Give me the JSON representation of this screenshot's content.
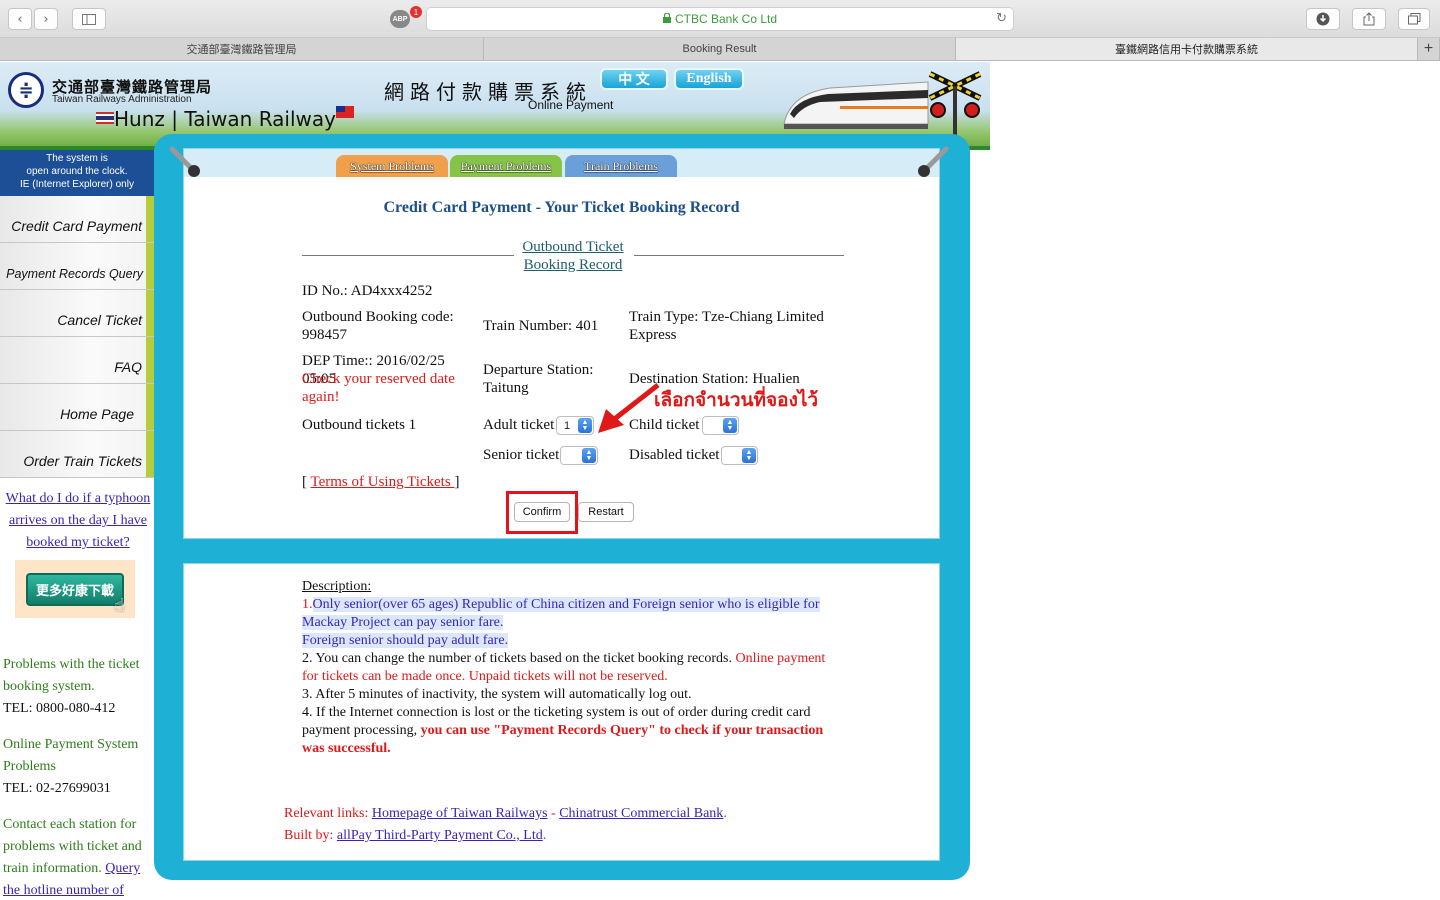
{
  "browser": {
    "url": "CTBC Bank Co Ltd",
    "abp_label": "ABP",
    "abp_badge": "1",
    "tabs": [
      {
        "label": "交通部臺灣鐵路管理局"
      },
      {
        "label": "Booking Result"
      },
      {
        "label": "臺鐵網路信用卡付款購票系統"
      }
    ]
  },
  "header": {
    "org_cn": "交通部臺灣鐵路管理局",
    "org_en": "Taiwan Railways Administration",
    "watermark": "Hunz | Taiwan Railway",
    "system_cn": "網路付款購票系統",
    "system_en": "Online Payment",
    "lang_cn": "中 文",
    "lang_en": "English"
  },
  "sidebar": {
    "system_note": [
      "The system is",
      "open around the clock.",
      "IE (Internet Explorer) only"
    ],
    "nav": [
      {
        "label": "Credit Card Payment"
      },
      {
        "label": "Payment Records Query"
      },
      {
        "label": "Cancel Ticket"
      },
      {
        "label": "FAQ"
      },
      {
        "label": "Home Page"
      },
      {
        "label": "Order Train Tickets"
      }
    ],
    "typhoon_link": "What do I do if a typhoon arrives on the day I have booked my ticket?",
    "download_banner": "更多好康下載",
    "ticket_problems": "Problems with the ticket booking system.",
    "ticket_tel": "TEL: 0800-080-412",
    "payment_problems": "Online Payment System Problems",
    "payment_tel": "TEL: 02-27699031",
    "contact_text": "Contact each station for problems with ticket and train information.",
    "contact_link": "Query the hotline number of"
  },
  "panel_tabs": [
    {
      "label": "System Problems",
      "color": "#f0a04a"
    },
    {
      "label": "Payment Problems",
      "color": "#86c447"
    },
    {
      "label": "Train Problems",
      "color": "#6b9fd8"
    }
  ],
  "booking": {
    "title": "Credit Card Payment - Your Ticket Booking Record",
    "section_title": "Outbound Ticket Booking Record",
    "id_no": "ID No.: AD4xxx4252",
    "booking_code": "Outbound Booking code: 998457",
    "train_number": "Train Number: 401",
    "train_type": "Train Type: Tze-Chiang Limited Express",
    "dep_time": "DEP Time:: 2016/02/25 05:05",
    "check_warning": "Check your reserved date again!",
    "departure_station": "Departure Station: Taitung",
    "destination_station": "Destination Station: Hualien",
    "outbound_tickets": "Outbound tickets 1",
    "adult_label": "Adult ticket",
    "adult_value": "1",
    "child_label": "Child ticket",
    "child_value": "",
    "senior_label": "Senior ticket",
    "senior_value": "",
    "disabled_label": "Disabled ticket",
    "disabled_value": "",
    "terms_open": "[ ",
    "terms_link": "Terms of Using Tickets ",
    "terms_close": "]",
    "confirm": "Confirm",
    "restart": "Restart",
    "annotation": "เลือกจำนวนที่จองไว้",
    "annotation_color": "#e01818"
  },
  "description": {
    "heading": "Description: ",
    "p1_num": "1.",
    "p1": "Only senior(over 65 ages) Republic of China citizen and Foreign senior who is eligible for Mackay Project can pay senior fare.",
    "p1b": "Foreign senior should pay adult fare.",
    "p2a": "2. You can change the number of tickets based on the ticket booking records. ",
    "p2b": "Online payment for tickets can be made once. Unpaid tickets will not be reserved.",
    "p3": "3. After 5 minutes of inactivity, the system will automatically log out.",
    "p4a": "4. If the Internet connection is lost or the ticketing system is out of order during credit card payment processing, ",
    "p4b": "you can use \"Payment Records Query\" to check if your transaction was successful."
  },
  "footer": {
    "relevant_label": "Relevant links: ",
    "link1": "Homepage of Taiwan Railways",
    "sep": " - ",
    "link2": "Chinatrust Commercial Bank",
    "dot1": ".",
    "built_label": "Built by: ",
    "link3": "allPay Third-Party Payment Co., Ltd",
    "dot2": "."
  }
}
